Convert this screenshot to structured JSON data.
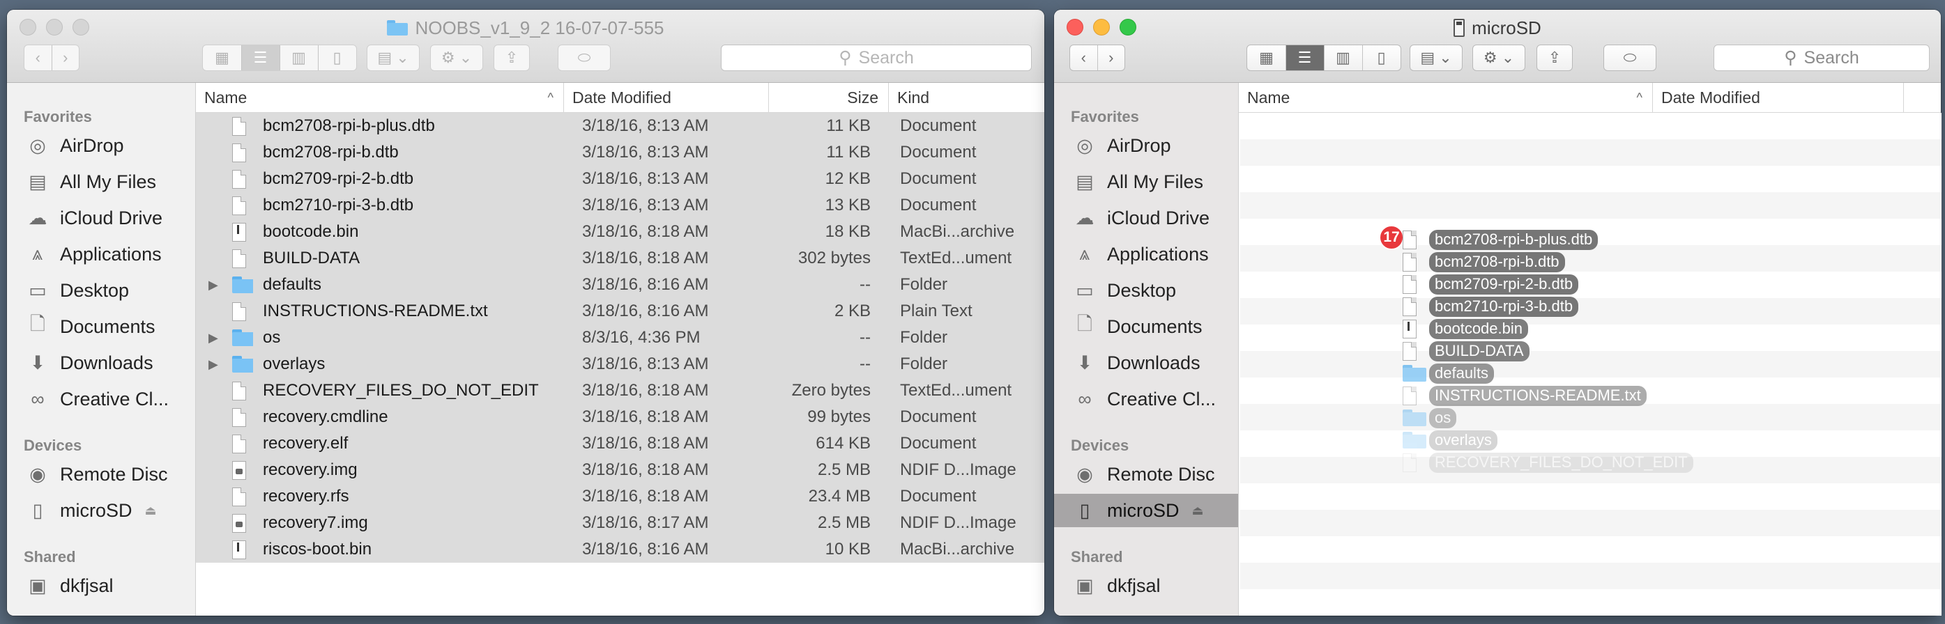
{
  "left_window": {
    "title": "NOOBS_v1_9_2 16-07-07-555",
    "search_placeholder": "Search",
    "columns": {
      "name": "Name",
      "date": "Date Modified",
      "size": "Size",
      "kind": "Kind"
    },
    "sidebar": {
      "favorites_header": "Favorites",
      "favorites": [
        {
          "label": "AirDrop",
          "icon": "airdrop-icon"
        },
        {
          "label": "All My Files",
          "icon": "all-my-files-icon"
        },
        {
          "label": "iCloud Drive",
          "icon": "cloud-icon"
        },
        {
          "label": "Applications",
          "icon": "applications-icon"
        },
        {
          "label": "Desktop",
          "icon": "desktop-icon"
        },
        {
          "label": "Documents",
          "icon": "documents-icon"
        },
        {
          "label": "Downloads",
          "icon": "downloads-icon"
        },
        {
          "label": "Creative Cl...",
          "icon": "creative-cloud-icon"
        }
      ],
      "devices_header": "Devices",
      "devices": [
        {
          "label": "Remote Disc",
          "icon": "disc-icon"
        },
        {
          "label": "microSD",
          "icon": "sd-card-icon"
        }
      ],
      "shared_header": "Shared",
      "shared": [
        {
          "label": "dkfjsal",
          "icon": "computer-icon"
        }
      ]
    },
    "files": [
      {
        "name": "bcm2708-rpi-b-plus.dtb",
        "date": "3/18/16, 8:13 AM",
        "size": "11 KB",
        "kind": "Document",
        "type": "doc"
      },
      {
        "name": "bcm2708-rpi-b.dtb",
        "date": "3/18/16, 8:13 AM",
        "size": "11 KB",
        "kind": "Document",
        "type": "doc"
      },
      {
        "name": "bcm2709-rpi-2-b.dtb",
        "date": "3/18/16, 8:13 AM",
        "size": "12 KB",
        "kind": "Document",
        "type": "doc"
      },
      {
        "name": "bcm2710-rpi-3-b.dtb",
        "date": "3/18/16, 8:13 AM",
        "size": "13 KB",
        "kind": "Document",
        "type": "doc"
      },
      {
        "name": "bootcode.bin",
        "date": "3/18/16, 8:18 AM",
        "size": "18 KB",
        "kind": "MacBi...archive",
        "type": "bin"
      },
      {
        "name": "BUILD-DATA",
        "date": "3/18/16, 8:18 AM",
        "size": "302 bytes",
        "kind": "TextEd...ument",
        "type": "doc"
      },
      {
        "name": "defaults",
        "date": "3/18/16, 8:16 AM",
        "size": "--",
        "kind": "Folder",
        "type": "folder"
      },
      {
        "name": "INSTRUCTIONS-README.txt",
        "date": "3/18/16, 8:16 AM",
        "size": "2 KB",
        "kind": "Plain Text",
        "type": "doc"
      },
      {
        "name": "os",
        "date": "8/3/16, 4:36 PM",
        "size": "--",
        "kind": "Folder",
        "type": "folder"
      },
      {
        "name": "overlays",
        "date": "3/18/16, 8:13 AM",
        "size": "--",
        "kind": "Folder",
        "type": "folder"
      },
      {
        "name": "RECOVERY_FILES_DO_NOT_EDIT",
        "date": "3/18/16, 8:18 AM",
        "size": "Zero bytes",
        "kind": "TextEd...ument",
        "type": "doc"
      },
      {
        "name": "recovery.cmdline",
        "date": "3/18/16, 8:18 AM",
        "size": "99 bytes",
        "kind": "Document",
        "type": "doc"
      },
      {
        "name": "recovery.elf",
        "date": "3/18/16, 8:18 AM",
        "size": "614 KB",
        "kind": "Document",
        "type": "doc"
      },
      {
        "name": "recovery.img",
        "date": "3/18/16, 8:18 AM",
        "size": "2.5 MB",
        "kind": "NDIF D...Image",
        "type": "img"
      },
      {
        "name": "recovery.rfs",
        "date": "3/18/16, 8:18 AM",
        "size": "23.4 MB",
        "kind": "Document",
        "type": "doc"
      },
      {
        "name": "recovery7.img",
        "date": "3/18/16, 8:17 AM",
        "size": "2.5 MB",
        "kind": "NDIF D...Image",
        "type": "img"
      },
      {
        "name": "riscos-boot.bin",
        "date": "3/18/16, 8:16 AM",
        "size": "10 KB",
        "kind": "MacBi...archive",
        "type": "bin"
      }
    ]
  },
  "right_window": {
    "title": "microSD",
    "search_placeholder": "Search",
    "columns": {
      "name": "Name",
      "date": "Date Modified"
    },
    "sidebar": {
      "favorites_header": "Favorites",
      "favorites": [
        {
          "label": "AirDrop"
        },
        {
          "label": "All My Files"
        },
        {
          "label": "iCloud Drive"
        },
        {
          "label": "Applications"
        },
        {
          "label": "Desktop"
        },
        {
          "label": "Documents"
        },
        {
          "label": "Downloads"
        },
        {
          "label": "Creative Cl..."
        }
      ],
      "devices_header": "Devices",
      "devices": [
        {
          "label": "Remote Disc"
        },
        {
          "label": "microSD"
        }
      ],
      "shared_header": "Shared",
      "shared": [
        {
          "label": "dkfjsal"
        }
      ]
    },
    "drag": {
      "count": "17",
      "items": [
        {
          "name": "bcm2708-rpi-b-plus.dtb",
          "type": "doc",
          "opacity": 1.0
        },
        {
          "name": "bcm2708-rpi-b.dtb",
          "type": "doc",
          "opacity": 1.0
        },
        {
          "name": "bcm2709-rpi-2-b.dtb",
          "type": "doc",
          "opacity": 1.0
        },
        {
          "name": "bcm2710-rpi-3-b.dtb",
          "type": "doc",
          "opacity": 1.0
        },
        {
          "name": "bootcode.bin",
          "type": "bin",
          "opacity": 0.95
        },
        {
          "name": "BUILD-DATA",
          "type": "doc",
          "opacity": 0.9
        },
        {
          "name": "defaults",
          "type": "folder",
          "opacity": 0.75
        },
        {
          "name": "INSTRUCTIONS-README.txt",
          "type": "doc",
          "opacity": 0.6
        },
        {
          "name": "os",
          "type": "folder",
          "opacity": 0.45
        },
        {
          "name": "overlays",
          "type": "folder",
          "opacity": 0.3
        },
        {
          "name": "RECOVERY_FILES_DO_NOT_EDIT",
          "type": "doc",
          "opacity": 0.15
        }
      ]
    }
  }
}
